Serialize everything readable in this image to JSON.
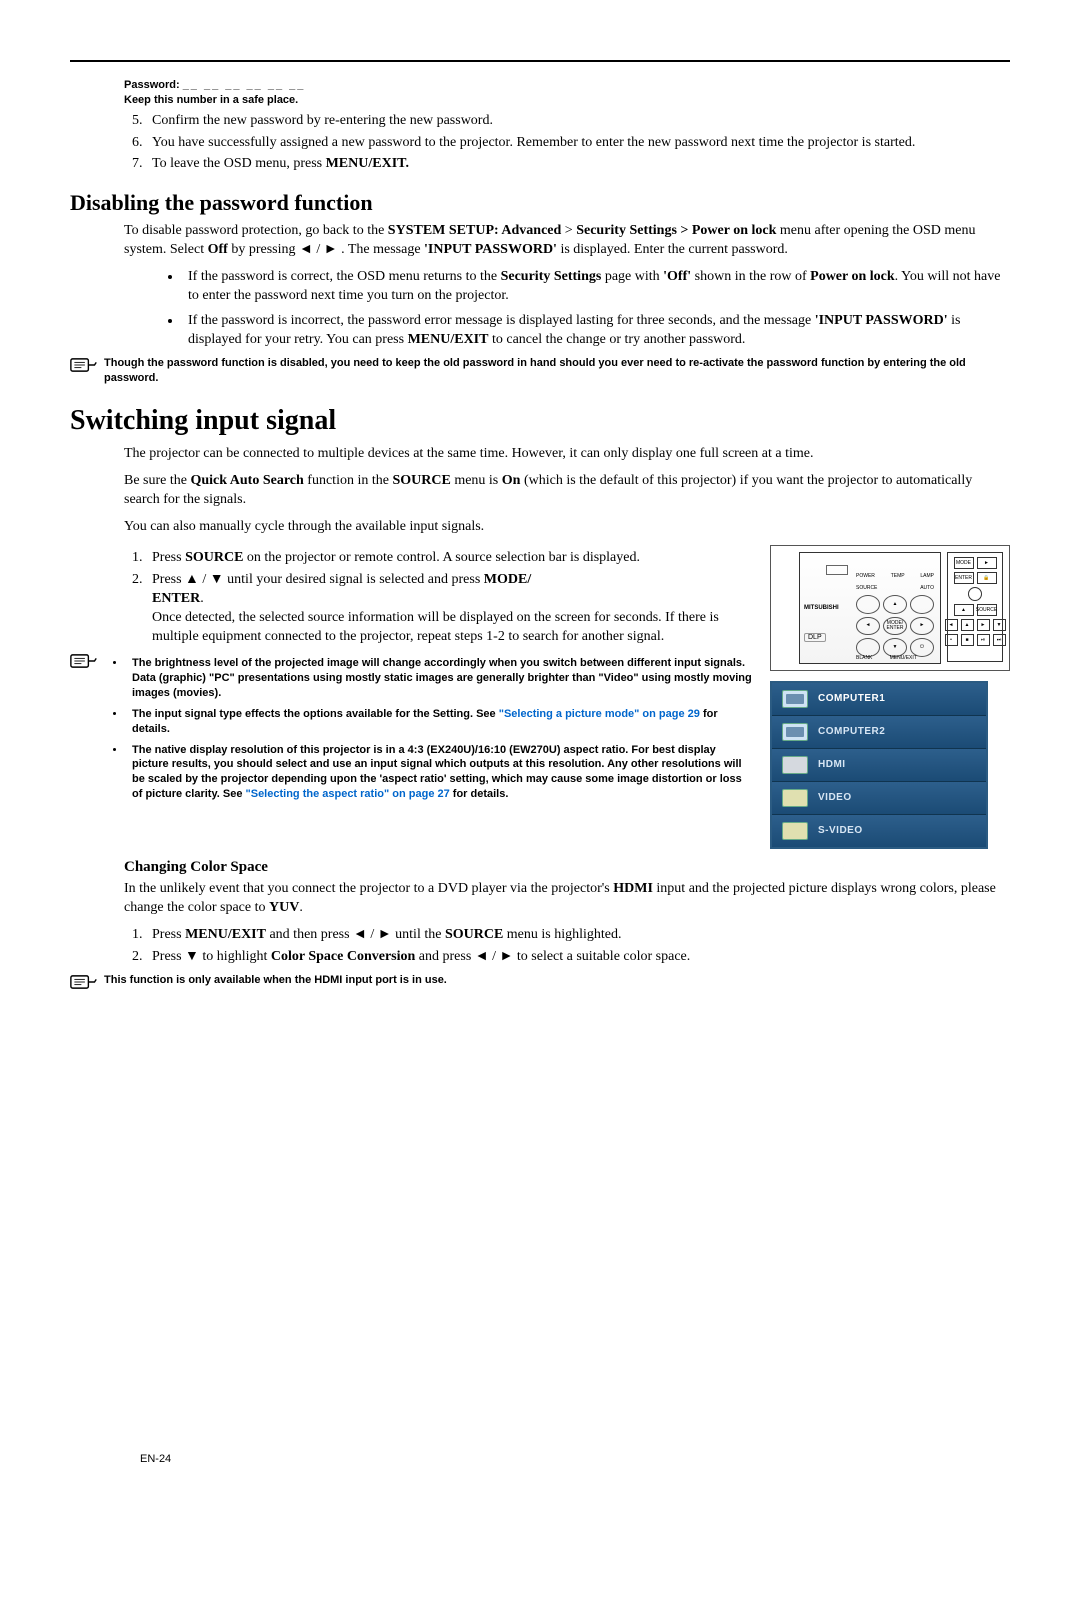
{
  "header": {
    "password_label": "Password: ",
    "password_blanks": "__ __ __ __ __ __",
    "keep_note": "Keep this number in a safe place."
  },
  "list_a": {
    "start": 5,
    "items": [
      "Confirm the new password by re-entering the new password.",
      "You have successfully assigned a new password to the projector. Remember to enter the new password next time the projector is started.",
      "To leave the OSD menu, press MENU/EXIT."
    ],
    "item3_prefix": "To leave the OSD menu, press ",
    "item3_bold": "MENU/EXIT."
  },
  "disable": {
    "heading": "Disabling the password function",
    "p1_a": "To disable password protection, go back to the ",
    "p1_b": "SYSTEM SETUP: Advanced",
    "p1_c": " > ",
    "p1_d": "Security Settings > Power on lock",
    "p1_e": " menu after opening the OSD menu system. Select ",
    "p1_f": "Off",
    "p1_g": " by pressing ◄ / ► . The message ",
    "p1_h": "'INPUT PASSWORD'",
    "p1_i": " is displayed. Enter the current password.",
    "b1_a": "If the password is correct, the OSD menu returns to the ",
    "b1_b": "Security Settings",
    "b1_c": " page with ",
    "b1_d": "'Off'",
    "b1_e": " shown in the row of ",
    "b1_f": "Power on lock",
    "b1_g": ". You will not have to enter the password next time you turn on the projector.",
    "b2_a": "If the password is incorrect, the password error message is displayed lasting for three seconds, and the message ",
    "b2_b": "'INPUT PASSWORD'",
    "b2_c": " is displayed for your retry. You can press ",
    "b2_d": "MENU/EXIT",
    "b2_e": " to cancel the change or try another password.",
    "note": "Though the password function is disabled, you need to keep the old password in hand should you ever need to re-activate the password function by entering the old password."
  },
  "switch": {
    "heading": "Switching input signal",
    "p1": "The projector can be connected to multiple devices at the same time. However, it can only display one full screen at a time.",
    "p2_a": "Be sure the ",
    "p2_b": "Quick Auto Search",
    "p2_c": " function in the ",
    "p2_d": "SOURCE",
    "p2_e": " menu is ",
    "p2_f": "On",
    "p2_g": " (which is the default of this projector) if you want the projector to automatically search for the signals.",
    "p3": "You can also manually cycle through the available input signals.",
    "s1_a": "Press ",
    "s1_b": "SOURCE",
    "s1_c": " on the projector or remote control. A source selection bar is displayed.",
    "s2_a": "Press ▲ / ▼  until your desired signal is selected and press ",
    "s2_b": "MODE/",
    "s2_c": "ENTER",
    "s2_d": ".",
    "s2_e": "Once detected, the selected source information will be displayed on the screen for seconds. If there is multiple equipment connected to the projector, repeat steps 1-2 to search for another signal.",
    "n1": "The brightness level of the projected image will change accordingly when you switch between different input signals. Data (graphic) \"PC\" presentations using mostly static images are generally brighter than \"Video\" using mostly moving images (movies).",
    "n2_a": "The input signal type effects the options available for the Setting. See ",
    "n2_b": "\"Selecting a picture mode\" on page 29",
    "n2_c": " for details.",
    "n3_a": "The native display resolution of this projector is in a 4:3 (EX240U)/16:10 (EW270U) aspect ratio. For best display picture results, you should select and use an input signal which outputs at this resolution. Any other resolutions will be scaled by the projector depending upon the 'aspect ratio' setting, which may cause some image distortion or loss of picture clarity. See ",
    "n3_b": "\"Selecting the aspect ratio\" on page 27",
    "n3_c": " for details."
  },
  "colorspace": {
    "heading": "Changing Color Space",
    "p1_a": "In the unlikely event that you connect the projector to a DVD player via the projector's ",
    "p1_b": "HDMI",
    "p1_c": " input and the projected picture displays wrong colors, please change the color space to ",
    "p1_d": "YUV",
    "p1_e": ".",
    "s1_a": "Press ",
    "s1_b": "MENU/EXIT",
    "s1_c": " and then press ◄ / ►  until the ",
    "s1_d": "SOURCE",
    "s1_e": " menu is highlighted.",
    "s2_a": "Press ▼ to highlight ",
    "s2_b": "Color Space Conversion",
    "s2_c": " and press ◄ / ►  to select a suitable color space.",
    "note": "This function is only available when the HDMI input port is in use."
  },
  "figure": {
    "panel": {
      "brand": "MITSUBISHI",
      "dlp": "DLP",
      "leds": [
        "POWER",
        "TEMP",
        "LAMP"
      ],
      "top_labels": [
        "SOURCE",
        "",
        "AUTO"
      ],
      "mid": "MODE/ ENTER",
      "bot_labels": [
        "BLANK",
        "MENU/EXIT",
        ""
      ],
      "arrows": {
        "up": "▲",
        "down": "▼",
        "left": "◄",
        "right": "►"
      },
      "power_icon": "⏻"
    },
    "remote": {
      "rows": [
        [
          "MODE",
          "►"
        ],
        [
          "ENTER",
          "🔒"
        ],
        [
          "▼",
          ""
        ],
        [
          "▲",
          "SOURCE"
        ]
      ],
      "grid": [
        "◄",
        "▲",
        "►",
        "▼",
        "•",
        "■",
        "⏯",
        "⏭"
      ]
    },
    "sources": [
      {
        "icon": "dsub",
        "label": "COMPUTER1",
        "active": true
      },
      {
        "icon": "dsub",
        "label": "COMPUTER2",
        "active": false
      },
      {
        "icon": "hdmi",
        "label": "HDMI",
        "active": false
      },
      {
        "icon": "rca",
        "label": "VIDEO",
        "active": false
      },
      {
        "icon": "rca",
        "label": "S-VIDEO",
        "active": false
      }
    ]
  },
  "page_num": "EN-24"
}
